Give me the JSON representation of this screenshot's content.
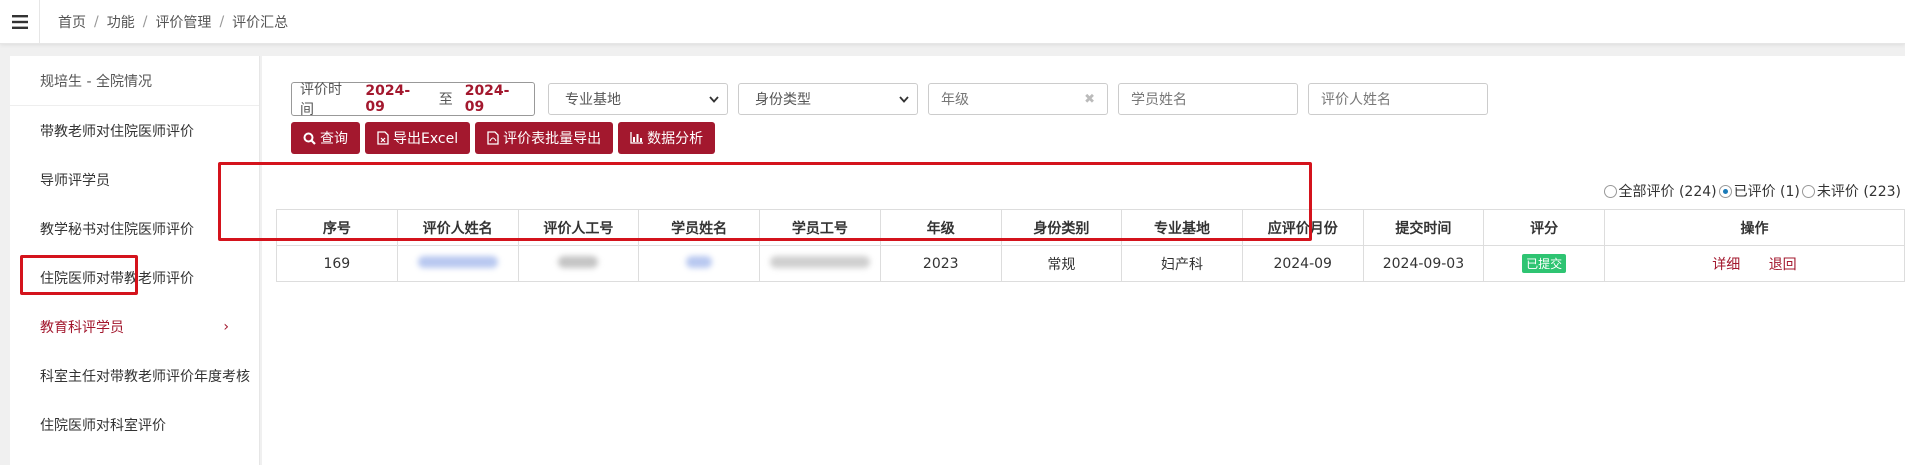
{
  "breadcrumb": {
    "items": [
      "首页",
      "功能",
      "评价管理",
      "评价汇总"
    ],
    "separator": "/"
  },
  "sidebar": {
    "header": "规培生 - 全院情况",
    "items": [
      {
        "label": "带教老师对住院医师评价"
      },
      {
        "label": "导师评学员"
      },
      {
        "label": "教学秘书对住院医师评价"
      },
      {
        "label": "住院医师对带教老师评价"
      },
      {
        "label": "教育科评学员",
        "chevron": "›"
      },
      {
        "label": "科室主任对带教老师评价年度考核"
      },
      {
        "label": "住院医师对科室评价"
      }
    ],
    "active_index": 4
  },
  "filters": {
    "date_label": "评价时间",
    "date_from": "2024-09",
    "date_to_sep": "至",
    "date_to": "2024-09",
    "specialty_select": "专业基地",
    "identity_select": "身份类型",
    "grade_placeholder": "年级",
    "grade_clear": "✖",
    "student_name_placeholder": "学员姓名",
    "evaluator_name_placeholder": "评价人姓名"
  },
  "buttons": {
    "search": "查询",
    "export_excel": "导出Excel",
    "batch_export": "评价表批量导出",
    "analysis": "数据分析"
  },
  "radios": {
    "all": "全部评价 (224)",
    "evaluated": "已评价 (1)",
    "not_evaluated": "未评价 (223)",
    "selected": "evaluated"
  },
  "table": {
    "headers": [
      "序号",
      "评价人姓名",
      "评价人工号",
      "学员姓名",
      "学员工号",
      "年级",
      "身份类别",
      "专业基地",
      "应评价月份",
      "提交时间",
      "评分",
      "操作"
    ],
    "rows": [
      {
        "index": "169",
        "grade": "2023",
        "identity": "常规",
        "specialty": "妇产科",
        "month": "2024-09",
        "submit_time": "2024-09-03",
        "status": "已提交",
        "op_detail": "详细",
        "op_return": "退回"
      }
    ]
  },
  "colors": {
    "accent": "#a3182e",
    "status_green": "#2ec472",
    "highlight": "#d4131c"
  }
}
